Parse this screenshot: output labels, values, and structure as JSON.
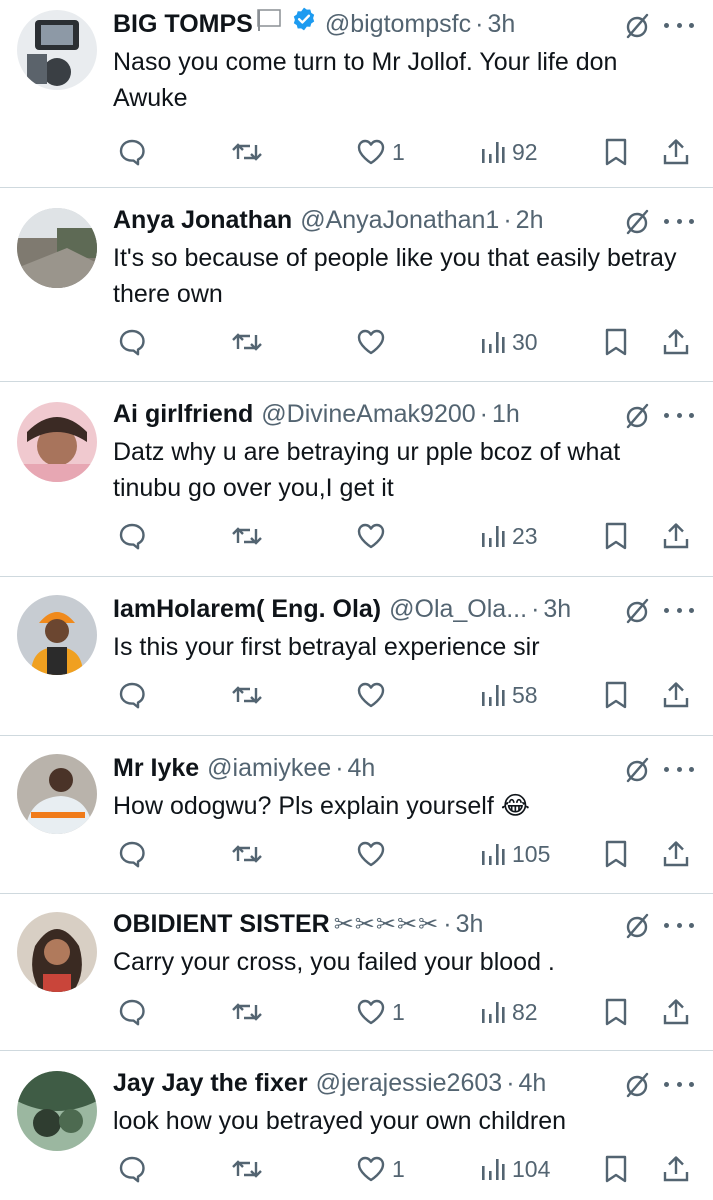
{
  "tweets": [
    {
      "name": "BIG TOMPS",
      "badge": "flag",
      "verified": true,
      "handle": "@bigtompsfc",
      "sep": "·",
      "time": "3h",
      "text": "Naso you come turn to Mr Jollof. Your life don Awuke",
      "likes": "1",
      "views": "92"
    },
    {
      "name": "Anya Jonathan",
      "handle": "@AnyaJonathan1",
      "sep": "·",
      "time": "2h",
      "text": "It's  so because of people like you that easily betray there own",
      "likes": "",
      "views": "30"
    },
    {
      "name": "Ai girlfriend",
      "handle": "@DivineAmak9200",
      "sep": "·",
      "time": "1h",
      "text": "Datz why u are betraying ur pple bcoz of what tinubu go over you,I get it",
      "likes": "",
      "views": "23"
    },
    {
      "name": "IamHolarem( Eng. Ola)",
      "handle": "@Ola_Ola...",
      "sep": "·",
      "time": "3h",
      "text": "Is this your first betrayal experience sir",
      "likes": "",
      "views": "58"
    },
    {
      "name": "Mr Iyke",
      "handle": "@iamiykee",
      "sep": "·",
      "time": "4h",
      "text": "How odogwu? Pls explain yourself 😂",
      "likes": "",
      "views": "105"
    },
    {
      "name": "OBIDIENT SISTER",
      "name_suffix": "✂✂✂✂✂",
      "handle": "",
      "sep": "·",
      "time": "3h",
      "text": "Carry your cross, you failed your blood .",
      "likes": "1",
      "views": "82"
    },
    {
      "name": "Jay Jay the fixer",
      "handle": "@jerajessie2603",
      "sep": "·",
      "time": "4h",
      "text": "look how you betrayed your own children",
      "likes": "1",
      "views": "104"
    }
  ],
  "colors": {
    "text": "#0f1419",
    "muted": "#536471",
    "verified": "#1d9bf0",
    "divider": "#cfd9de"
  },
  "icons": [
    "reply-icon",
    "retweet-icon",
    "like-icon",
    "views-icon",
    "bookmark-icon",
    "share-icon",
    "grok-icon",
    "more-icon",
    "verified-icon",
    "flag-icon"
  ]
}
